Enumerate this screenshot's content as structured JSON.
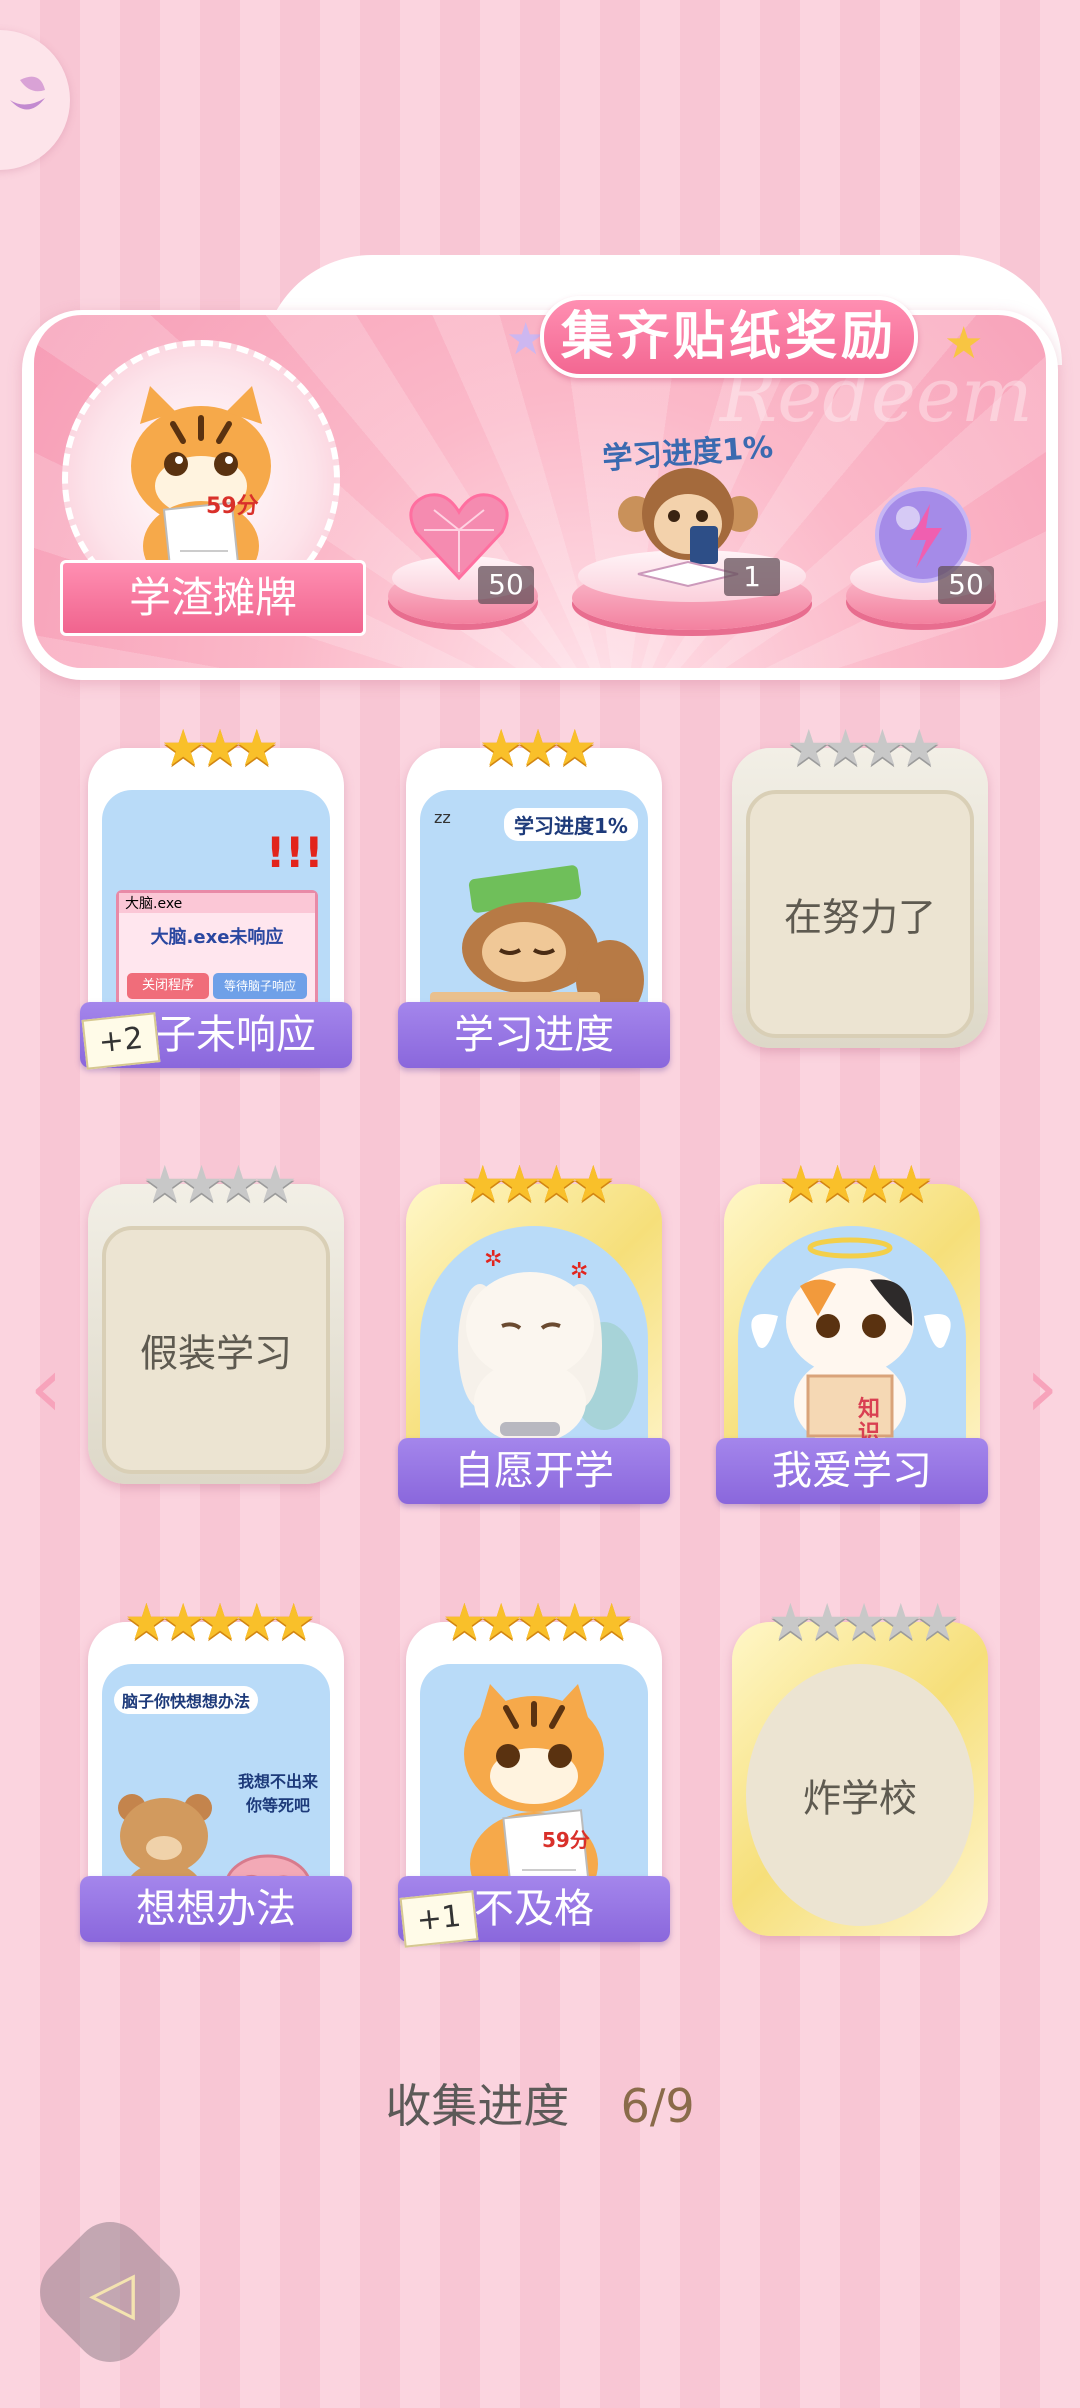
{
  "banner": {
    "title": "集齐贴纸奖励",
    "watermark": "Redeem",
    "sticker_name": "学渣摊牌",
    "sticker_score": "59分",
    "rewards": [
      {
        "icon": "heart-gem-icon",
        "count": "50"
      },
      {
        "icon": "monkey-study-icon",
        "caption": "学习进度1%",
        "count": "1"
      },
      {
        "icon": "lightning-orb-icon",
        "count": "50"
      }
    ]
  },
  "cards": [
    {
      "label": "脑子未响应",
      "stars": 3,
      "collected": true,
      "bonus": "+2",
      "art_lines": [
        "大脑.exe",
        "大脑.exe未响应",
        "关闭程序",
        "等待脑子响应"
      ]
    },
    {
      "label": "学习进度",
      "stars": 3,
      "collected": true,
      "art_lines": [
        "学习进度1%",
        "zz",
        "zz"
      ]
    },
    {
      "label": "在努力了",
      "stars": 4,
      "collected": false
    },
    {
      "label": "假装学习",
      "stars": 4,
      "collected": false
    },
    {
      "label": "自愿开学",
      "stars": 4,
      "collected": true
    },
    {
      "label": "我爱学习",
      "stars": 4,
      "collected": true,
      "art_lines": [
        "知识"
      ]
    },
    {
      "label": "想想办法",
      "stars": 5,
      "collected": true,
      "art_lines": [
        "脑子你快想想办法",
        "我想不出来",
        "你等死吧"
      ]
    },
    {
      "label": "不及格",
      "stars": 5,
      "collected": true,
      "bonus": "+1",
      "art_lines": [
        "59分"
      ]
    },
    {
      "label": "炸学校",
      "stars": 5,
      "collected": false
    }
  ],
  "progress": {
    "label": "收集进度",
    "value": "6/9"
  },
  "colors": {
    "label_purple": "#8a67dc",
    "pink": "#f7a3bb",
    "gold": "#f9c02a"
  }
}
